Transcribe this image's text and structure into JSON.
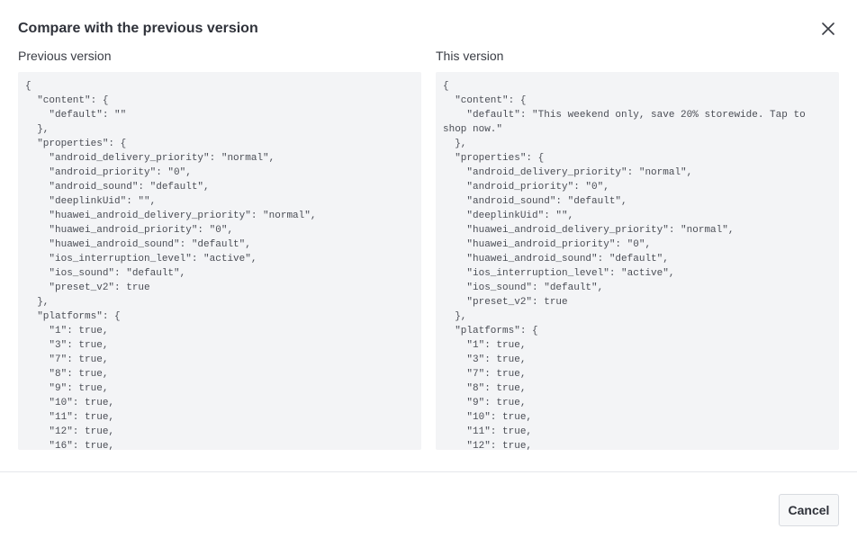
{
  "dialog": {
    "title": "Compare with the previous version",
    "close_icon": "close-icon",
    "cancel_label": "Cancel"
  },
  "previous": {
    "label": "Previous version",
    "code": "{\n  \"content\": {\n    \"default\": \"\"\n  },\n  \"properties\": {\n    \"android_delivery_priority\": \"normal\",\n    \"android_priority\": \"0\",\n    \"android_sound\": \"default\",\n    \"deeplinkUid\": \"\",\n    \"huawei_android_delivery_priority\": \"normal\",\n    \"huawei_android_priority\": \"0\",\n    \"huawei_android_sound\": \"default\",\n    \"ios_interruption_level\": \"active\",\n    \"ios_sound\": \"default\",\n    \"preset_v2\": true\n  },\n  \"platforms\": {\n    \"1\": true,\n    \"3\": true,\n    \"7\": true,\n    \"8\": true,\n    \"9\": true,\n    \"10\": true,\n    \"11\": true,\n    \"12\": true,\n    \"16\": true,"
  },
  "current": {
    "label": "This version",
    "code": "{\n  \"content\": {\n    \"default\": \"This weekend only, save 20% storewide. Tap to shop now.\"\n  },\n  \"properties\": {\n    \"android_delivery_priority\": \"normal\",\n    \"android_priority\": \"0\",\n    \"android_sound\": \"default\",\n    \"deeplinkUid\": \"\",\n    \"huawei_android_delivery_priority\": \"normal\",\n    \"huawei_android_priority\": \"0\",\n    \"huawei_android_sound\": \"default\",\n    \"ios_interruption_level\": \"active\",\n    \"ios_sound\": \"default\",\n    \"preset_v2\": true\n  },\n  \"platforms\": {\n    \"1\": true,\n    \"3\": true,\n    \"7\": true,\n    \"8\": true,\n    \"9\": true,\n    \"10\": true,\n    \"11\": true,\n    \"12\": true,"
  }
}
